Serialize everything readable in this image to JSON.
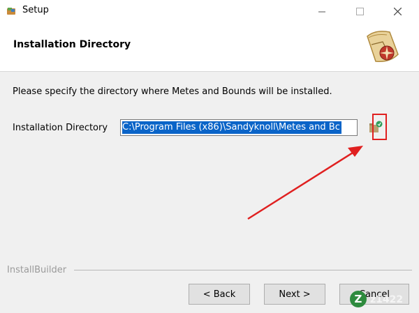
{
  "window": {
    "title": "Setup"
  },
  "header": {
    "title": "Installation Directory"
  },
  "main": {
    "description": "Please specify the directory where Metes and Bounds will be installed.",
    "dir_label": "Installation Directory",
    "dir_value": "C:\\Program Files (x86)\\Sandyknoll\\Metes and Bc"
  },
  "footer": {
    "brand": "InstallBuilder",
    "back_label": "< Back",
    "next_label": "Next >",
    "cancel_label": "Cancel"
  },
  "watermark": {
    "text": "z1422"
  },
  "colors": {
    "selection": "#0a64c8",
    "highlight_box": "#e02020",
    "arrow": "#e02020"
  },
  "icons": [
    "setup-app-icon",
    "minimize-icon",
    "maximize-icon",
    "close-icon",
    "installer-map-logo-icon",
    "folder-browse-icon",
    "watermark-z-icon"
  ]
}
